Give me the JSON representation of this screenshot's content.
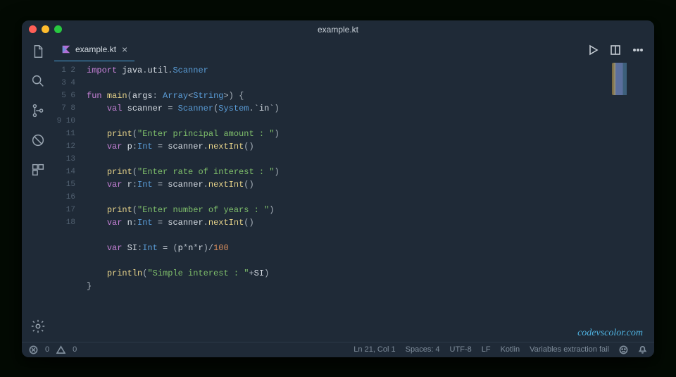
{
  "window": {
    "title": "example.kt"
  },
  "tab": {
    "filename": "example.kt",
    "close": "×"
  },
  "watermark": "codevscolor.com",
  "status": {
    "errors": "0",
    "warnings": "0",
    "cursor": "Ln 21, Col 1",
    "spaces": "Spaces: 4",
    "encoding": "UTF-8",
    "eol": "LF",
    "lang": "Kotlin",
    "extra": "Variables extraction fail"
  },
  "lines": [
    "1",
    "2",
    "3",
    "4",
    "5",
    "6",
    "7",
    "8",
    "9",
    "10",
    "11",
    "12",
    "13",
    "14",
    "15",
    "16",
    "17",
    "18"
  ],
  "code": {
    "l1a": "import",
    "l1b": "java",
    "l1c": "util",
    "l1d": "Scanner",
    "l3a": "fun",
    "l3b": "main",
    "l3c": "args",
    "l3d": "Array",
    "l3e": "String",
    "l4a": "val",
    "l4b": "scanner",
    "l4c": "Scanner",
    "l4d": "System",
    "l4e": "`in`",
    "l6a": "print",
    "l6b": "\"Enter principal amount : \"",
    "l7a": "var",
    "l7b": "p",
    "l7c": "Int",
    "l7d": "scanner",
    "l7e": "nextInt",
    "l9a": "print",
    "l9b": "\"Enter rate of interest : \"",
    "l10a": "var",
    "l10b": "r",
    "l10c": "Int",
    "l10d": "scanner",
    "l10e": "nextInt",
    "l12a": "print",
    "l12b": "\"Enter number of years : \"",
    "l13a": "var",
    "l13b": "n",
    "l13c": "Int",
    "l13d": "scanner",
    "l13e": "nextInt",
    "l15a": "var",
    "l15b": "SI",
    "l15c": "Int",
    "l15d": "p",
    "l15e": "n",
    "l15f": "r",
    "l15g": "100",
    "l17a": "println",
    "l17b": "\"Simple interest : \"",
    "l17c": "SI"
  }
}
